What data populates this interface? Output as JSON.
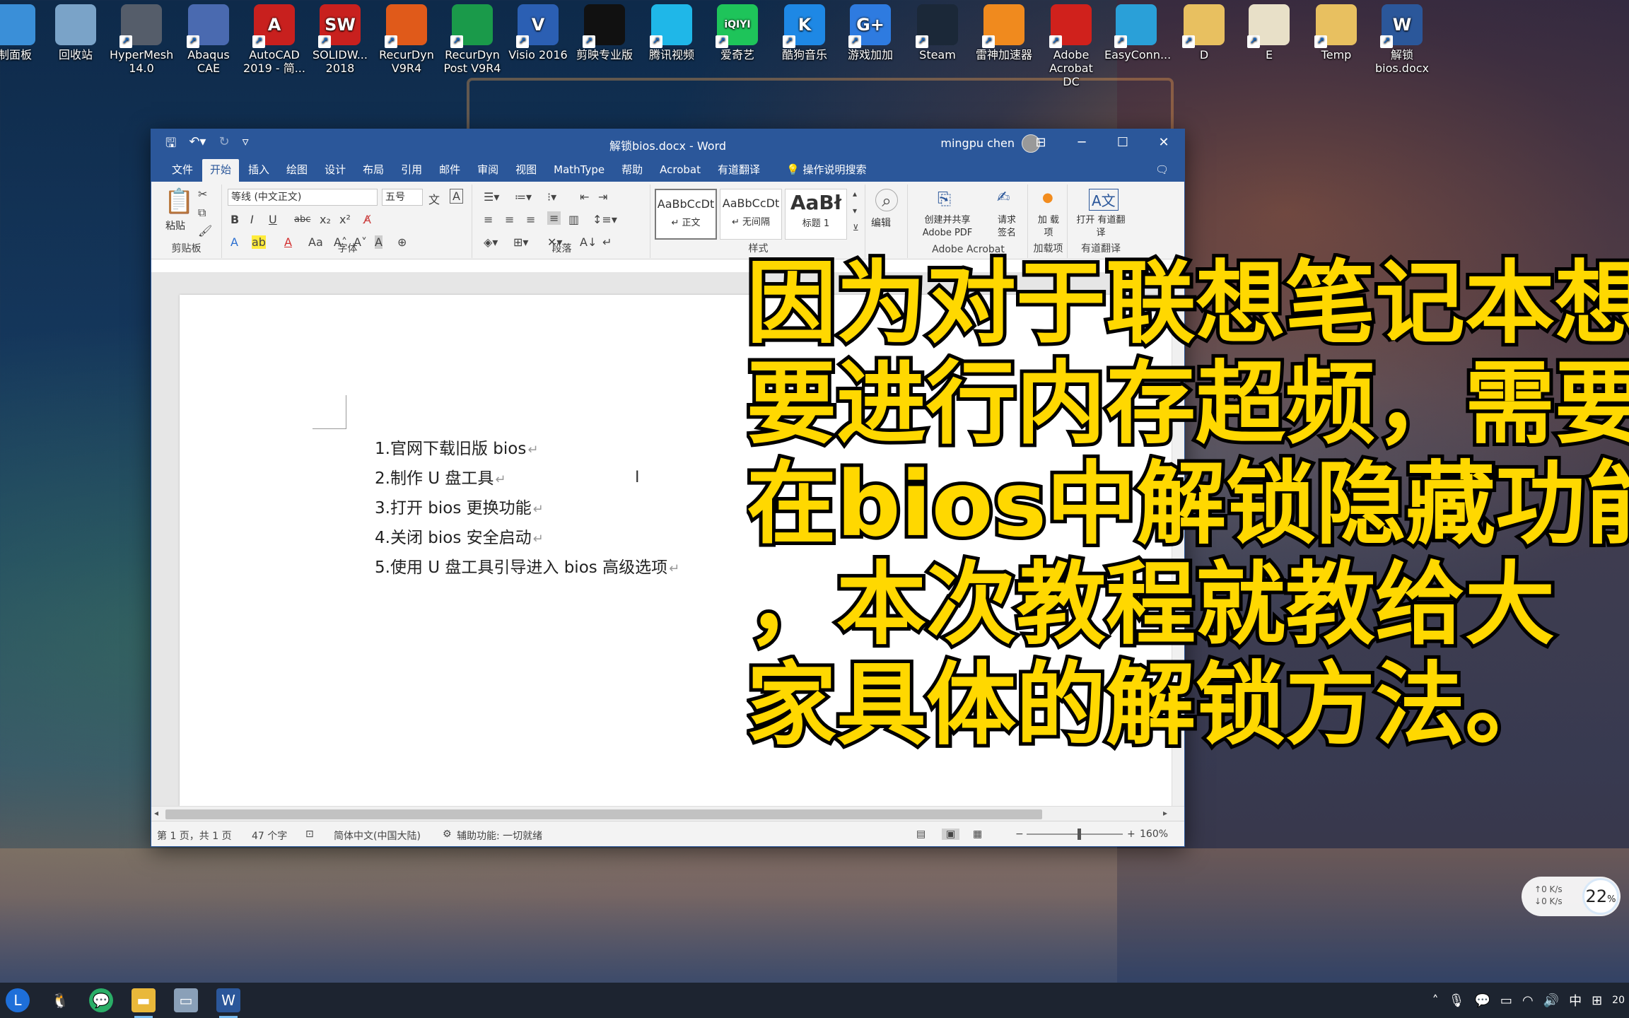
{
  "desktop": {
    "icons": [
      {
        "label": "制面板",
        "color": "#3a8fd8"
      },
      {
        "label": "回收站",
        "color": "#7aa3c8"
      },
      {
        "label": "HyperMesh 14.0",
        "color": "#555d6a"
      },
      {
        "label": "Abaqus CAE",
        "color": "#4a6ab0"
      },
      {
        "label": "AutoCAD 2019 - 简...",
        "color": "#c8201e",
        "glyph": "A"
      },
      {
        "label": "SOLIDW... 2018",
        "color": "#c8201e",
        "glyph": "SW"
      },
      {
        "label": "RecurDyn V9R4",
        "color": "#e05a1a"
      },
      {
        "label": "RecurDyn Post V9R4",
        "color": "#1a9a4a"
      },
      {
        "label": "Visio 2016",
        "color": "#2b5fb3",
        "glyph": "V"
      },
      {
        "label": "剪映专业版",
        "color": "#111111"
      },
      {
        "label": "腾讯视频",
        "color": "#1fb7e8"
      },
      {
        "label": "爱奇艺",
        "color": "#1ec45a",
        "glyph": "iQIYI"
      },
      {
        "label": "酷狗音乐",
        "color": "#1e88e5",
        "glyph": "K"
      },
      {
        "label": "游戏加加",
        "color": "#2e7be0",
        "glyph": "G+"
      },
      {
        "label": "Steam",
        "color": "#1b2838"
      },
      {
        "label": "雷神加速器",
        "color": "#f08a1e"
      },
      {
        "label": "Adobe Acrobat DC",
        "color": "#d0211c"
      },
      {
        "label": "EasyConn...",
        "color": "#2aa0d8"
      },
      {
        "label": "D",
        "color": "#e8c060"
      },
      {
        "label": "E",
        "color": "#e8e0c8"
      },
      {
        "label": "Temp",
        "color": "#e8c060"
      },
      {
        "label": "解锁 bios.docx",
        "color": "#2b579a",
        "glyph": "W"
      }
    ]
  },
  "word": {
    "title": "解锁bios.docx - Word",
    "user": "mingpu chen",
    "tabs": [
      "文件",
      "开始",
      "插入",
      "绘图",
      "设计",
      "布局",
      "引用",
      "邮件",
      "审阅",
      "视图",
      "MathType",
      "帮助",
      "Acrobat",
      "有道翻译"
    ],
    "active_tab": "开始",
    "search_label": "操作说明搜索",
    "ribbon": {
      "clipboard_group": "剪贴板",
      "paste_label": "粘贴",
      "font_group": "字体",
      "font_name": "等线 (中文正文)",
      "font_size": "五号",
      "paragraph_group": "段落",
      "styles_group": "样式",
      "styles": [
        {
          "sample": "AaBbCcDt",
          "name": "↵ 正文"
        },
        {
          "sample": "AaBbCcDt",
          "name": "↵ 无间隔"
        },
        {
          "sample": "AaBł",
          "name": "标题 1"
        }
      ],
      "edit_label": "编辑",
      "adobe_share": "创建并共享 Adobe PDF",
      "adobe_sign": "请求 签名",
      "adobe_group": "Adobe Acrobat",
      "addin_label": "加 载项",
      "addin_group": "加载项",
      "youdao_label": "打开 有道翻译",
      "youdao_group": "有道翻译"
    },
    "document_lines": [
      "1.官网下载旧版 bios",
      "2.制作 U 盘工具",
      "3.打开 bios 更换功能",
      "4.关闭 bios 安全启动",
      "5.使用 U 盘工具引导进入 bios 高级选项"
    ],
    "status": {
      "page": "第 1 页，共 1 页",
      "words": "47 个字",
      "language": "简体中文(中国大陆)",
      "accessibility": "辅助功能: 一切就绪",
      "zoom": "160%"
    }
  },
  "caption": {
    "lines": [
      "因为对于联想笔记本想",
      "要进行内存超频，需要",
      "在bios中解锁隐藏功能",
      "，本次教程就教给大",
      "家具体的解锁方法。"
    ]
  },
  "net_widget": {
    "up": "0  K/s",
    "down": "0  K/s",
    "percent": "22",
    "percent_unit": "%"
  },
  "taskbar": {
    "ime": "中",
    "clock": "20"
  }
}
